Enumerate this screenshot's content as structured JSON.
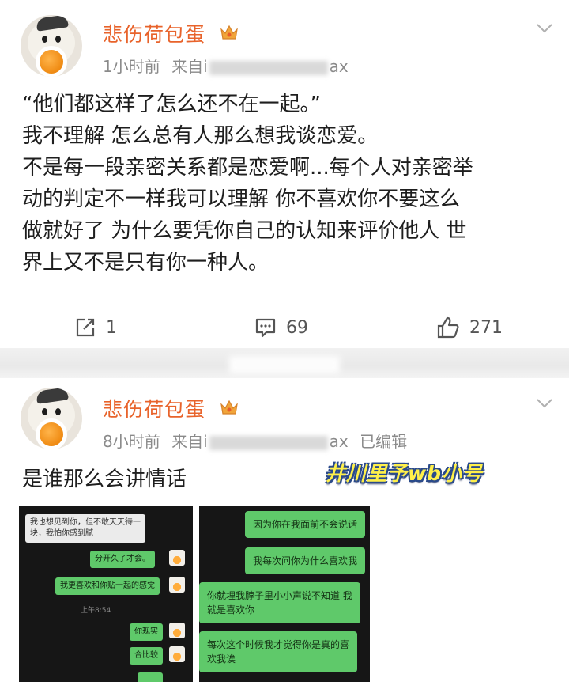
{
  "post1": {
    "username": "悲伤荷包蛋",
    "meta": {
      "time": "1小时前",
      "source_prefix": "来自i",
      "source_suffix": "ax"
    },
    "lines": [
      "“他们都这样了怎么还不在一起。”",
      "我不理解 怎么总有人那么想我谈恋爱。",
      "不是每一段亲密关系都是恋爱啊...每个人对亲密举",
      "动的判定不一样我可以理解 你不喜欢你不要这么",
      "做就好了 为什么要凭你自己的认知来评价他人 世",
      "界上又不是只有你一种人。"
    ],
    "actions": {
      "repost_count": "1",
      "comment_count": "69",
      "like_count": "271"
    }
  },
  "post2": {
    "username": "悲伤荷包蛋",
    "meta": {
      "time": "8小时前",
      "source_prefix": "来自i",
      "source_suffix": "ax",
      "edited": "已编辑"
    },
    "text": "是谁那么会讲情话",
    "watermark": "井川里予wb小号",
    "chat_left": {
      "received": "我也想见到你，但不敢天天待一\n块，我怕你感到腻",
      "sent": [
        "分开久了才会。",
        "我更喜欢和你贴一起的感觉",
        "你现实",
        "合比较"
      ],
      "timestamp": "上午8:54"
    },
    "chat_right": {
      "messages": [
        "因为你在我面前不会说话",
        "我每次问你为什么喜欢我",
        "你就埋我脖子里小小声说不知道 我\n就是喜欢你",
        "每次这个时候我才觉得你是真的喜\n欢我诶"
      ]
    }
  },
  "colors": {
    "username": "#e8632b",
    "chat_green": "#5fc96a",
    "meta_grey": "#8a8a8a"
  }
}
